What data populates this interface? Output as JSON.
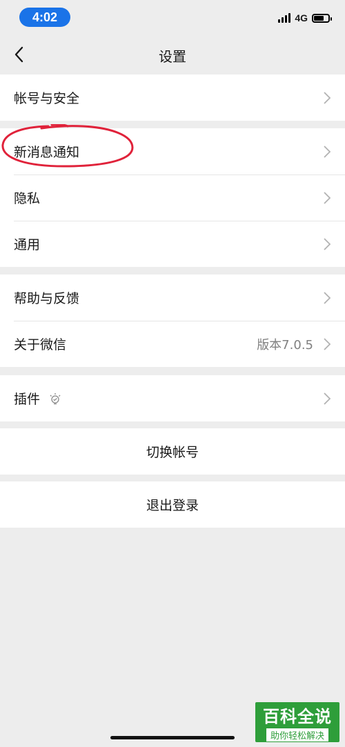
{
  "status_bar": {
    "time": "4:02",
    "network": "4G",
    "accent_color": "#1a73e8"
  },
  "nav": {
    "title": "设置",
    "back_icon": "chevron-left-icon"
  },
  "groups": [
    {
      "items": [
        {
          "label": "帐号与安全"
        }
      ]
    },
    {
      "items": [
        {
          "label": "新消息通知",
          "highlighted": true
        },
        {
          "label": "隐私"
        },
        {
          "label": "通用"
        }
      ]
    },
    {
      "items": [
        {
          "label": "帮助与反馈"
        },
        {
          "label": "关于微信",
          "value": "版本7.0.5"
        }
      ]
    },
    {
      "items": [
        {
          "label": "插件",
          "icon": "lightbulb-icon"
        }
      ]
    }
  ],
  "actions": {
    "switch_account": "切换帐号",
    "logout": "退出登录"
  },
  "watermark": {
    "main": "百科全说",
    "sub": "助你轻松解决",
    "color": "#2e9e3a"
  },
  "annotation_color": "#e0223a"
}
